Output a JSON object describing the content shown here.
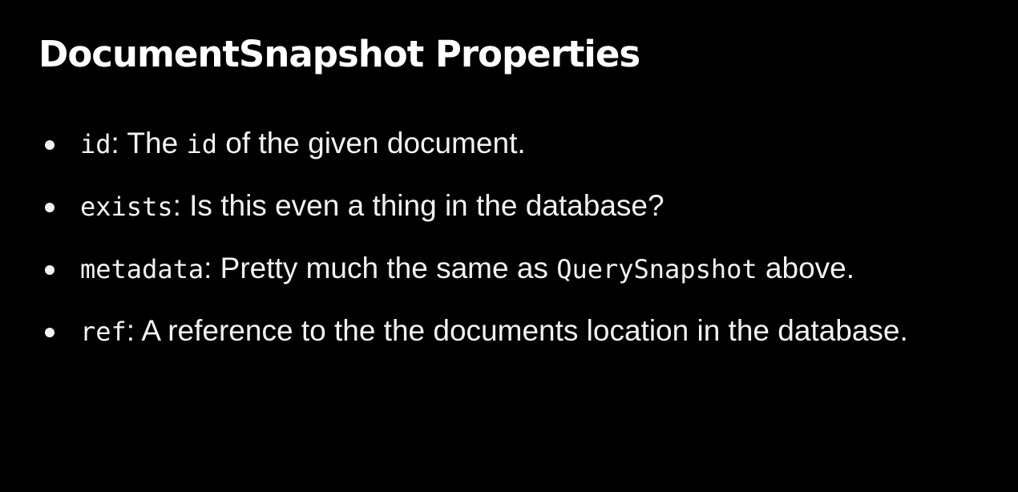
{
  "slide": {
    "title": "DocumentSnapshot Properties",
    "bullets": [
      {
        "parts": [
          {
            "text": "id",
            "code": true
          },
          {
            "text": ": The ",
            "code": false
          },
          {
            "text": "id",
            "code": true
          },
          {
            "text": " of the given document.",
            "code": false
          }
        ]
      },
      {
        "parts": [
          {
            "text": "exists",
            "code": true
          },
          {
            "text": ": Is this even a thing in the database?",
            "code": false
          }
        ]
      },
      {
        "parts": [
          {
            "text": "metadata",
            "code": true
          },
          {
            "text": ": Pretty much the same as ",
            "code": false
          },
          {
            "text": "QuerySnapshot",
            "code": true
          },
          {
            "text": " above.",
            "code": false
          }
        ]
      },
      {
        "parts": [
          {
            "text": "ref",
            "code": true
          },
          {
            "text": ": A reference to the the documents location in the database.",
            "code": false
          }
        ]
      }
    ]
  }
}
